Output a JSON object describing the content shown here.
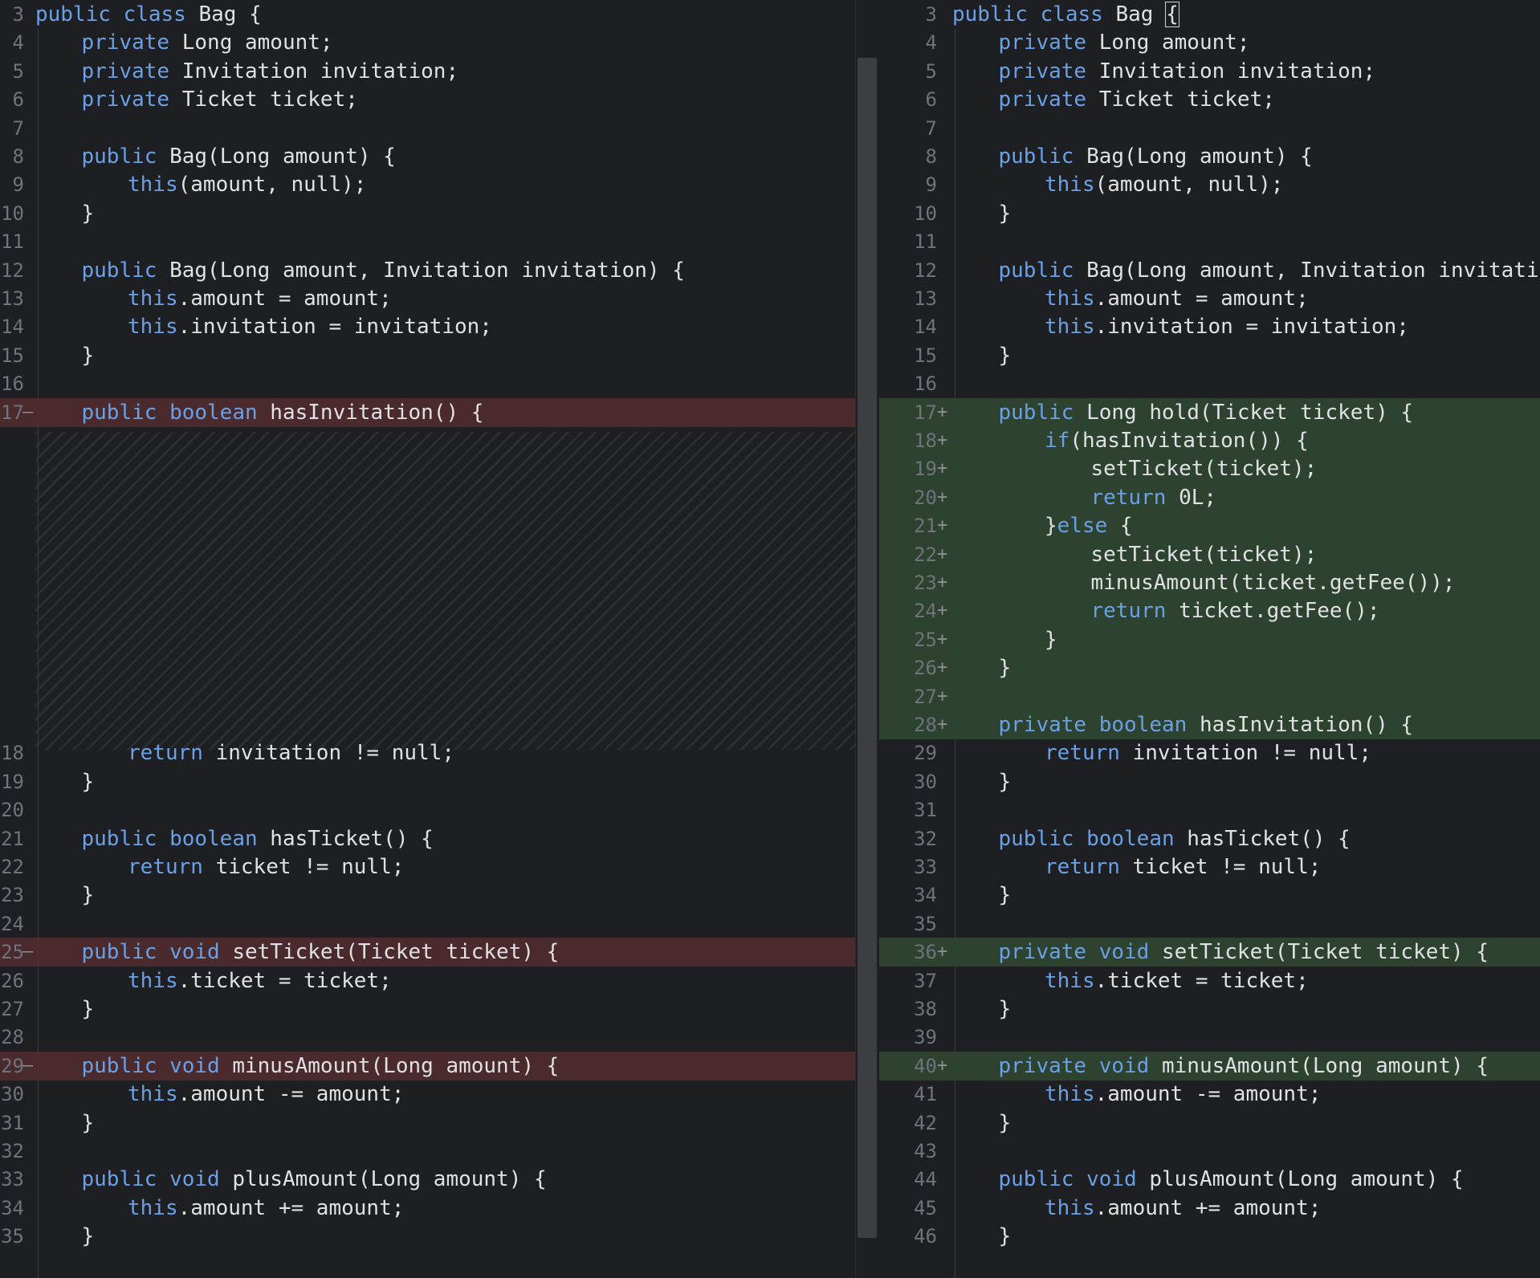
{
  "colors": {
    "background": "#1e1f22",
    "keyword": "#6aa0e6",
    "text": "#dfe1e5",
    "line_number": "#6f737a",
    "removed_bg": "#4a2a2d",
    "added_bg": "#2e4230"
  },
  "left_pane": {
    "rows": [
      {
        "line": "3",
        "marker": "",
        "status": "",
        "segments": [
          [
            "kw",
            "public class"
          ],
          [
            "",
            "Bag {"
          ]
        ],
        "indent": 0
      },
      {
        "line": "4",
        "marker": "",
        "status": "",
        "segments": [
          [
            "kw",
            "private"
          ],
          [
            "",
            " Long amount;"
          ]
        ],
        "indent": 1
      },
      {
        "line": "5",
        "marker": "",
        "status": "",
        "segments": [
          [
            "kw",
            "private"
          ],
          [
            "",
            " Invitation invitation;"
          ]
        ],
        "indent": 1
      },
      {
        "line": "6",
        "marker": "",
        "status": "",
        "segments": [
          [
            "kw",
            "private"
          ],
          [
            "",
            " Ticket ticket;"
          ]
        ],
        "indent": 1
      },
      {
        "line": "7",
        "marker": "",
        "status": "",
        "segments": [],
        "indent": 0
      },
      {
        "line": "8",
        "marker": "",
        "status": "",
        "segments": [
          [
            "kw",
            "public"
          ],
          [
            "",
            " Bag(Long amount) {"
          ]
        ],
        "indent": 1
      },
      {
        "line": "9",
        "marker": "",
        "status": "",
        "segments": [
          [
            "kw",
            "this"
          ],
          [
            "",
            "(amount, null);"
          ]
        ],
        "indent": 2
      },
      {
        "line": "10",
        "marker": "",
        "status": "",
        "segments": [
          [
            "",
            "}"
          ]
        ],
        "indent": 1
      },
      {
        "line": "11",
        "marker": "",
        "status": "",
        "segments": [],
        "indent": 0
      },
      {
        "line": "12",
        "marker": "",
        "status": "",
        "segments": [
          [
            "kw",
            "public"
          ],
          [
            "",
            " Bag(Long amount, Invitation invitation) {"
          ]
        ],
        "indent": 1
      },
      {
        "line": "13",
        "marker": "",
        "status": "",
        "segments": [
          [
            "kw",
            "this"
          ],
          [
            "",
            ".amount = amount;"
          ]
        ],
        "indent": 2
      },
      {
        "line": "14",
        "marker": "",
        "status": "",
        "segments": [
          [
            "kw",
            "this"
          ],
          [
            "",
            ".invitation = invitation;"
          ]
        ],
        "indent": 2
      },
      {
        "line": "15",
        "marker": "",
        "status": "",
        "segments": [
          [
            "",
            "}"
          ]
        ],
        "indent": 1
      },
      {
        "line": "16",
        "marker": "",
        "status": "",
        "segments": [],
        "indent": 0
      },
      {
        "line": "17",
        "marker": "–",
        "status": "removed",
        "segments": [
          [
            "kw",
            "public boolean"
          ],
          [
            "",
            " hasInvitation() {"
          ]
        ],
        "indent": 1
      },
      {
        "line": "",
        "marker": "",
        "status": "filler",
        "segments": [],
        "indent": 0
      },
      {
        "line": "",
        "marker": "",
        "status": "filler",
        "segments": [],
        "indent": 0
      },
      {
        "line": "",
        "marker": "",
        "status": "filler",
        "segments": [],
        "indent": 0
      },
      {
        "line": "",
        "marker": "",
        "status": "filler",
        "segments": [],
        "indent": 0
      },
      {
        "line": "",
        "marker": "",
        "status": "filler",
        "segments": [],
        "indent": 0
      },
      {
        "line": "",
        "marker": "",
        "status": "filler",
        "segments": [],
        "indent": 0
      },
      {
        "line": "",
        "marker": "",
        "status": "filler",
        "segments": [],
        "indent": 0
      },
      {
        "line": "",
        "marker": "",
        "status": "filler",
        "segments": [],
        "indent": 0
      },
      {
        "line": "",
        "marker": "",
        "status": "filler",
        "segments": [],
        "indent": 0
      },
      {
        "line": "",
        "marker": "",
        "status": "filler",
        "segments": [],
        "indent": 0
      },
      {
        "line": "",
        "marker": "",
        "status": "filler",
        "segments": [],
        "indent": 0
      },
      {
        "line": "18",
        "marker": "",
        "status": "",
        "segments": [
          [
            "kw",
            "return"
          ],
          [
            "",
            " invitation != null;"
          ]
        ],
        "indent": 2
      },
      {
        "line": "19",
        "marker": "",
        "status": "",
        "segments": [
          [
            "",
            "}"
          ]
        ],
        "indent": 1
      },
      {
        "line": "20",
        "marker": "",
        "status": "",
        "segments": [],
        "indent": 0
      },
      {
        "line": "21",
        "marker": "",
        "status": "",
        "segments": [
          [
            "kw",
            "public boolean"
          ],
          [
            "",
            " hasTicket() {"
          ]
        ],
        "indent": 1
      },
      {
        "line": "22",
        "marker": "",
        "status": "",
        "segments": [
          [
            "kw",
            "return"
          ],
          [
            "",
            " ticket != null;"
          ]
        ],
        "indent": 2
      },
      {
        "line": "23",
        "marker": "",
        "status": "",
        "segments": [
          [
            "",
            "}"
          ]
        ],
        "indent": 1
      },
      {
        "line": "24",
        "marker": "",
        "status": "",
        "segments": [],
        "indent": 0
      },
      {
        "line": "25",
        "marker": "–",
        "status": "removed",
        "segments": [
          [
            "kw",
            "public void"
          ],
          [
            "",
            " setTicket(Ticket ticket) {"
          ]
        ],
        "indent": 1
      },
      {
        "line": "26",
        "marker": "",
        "status": "",
        "segments": [
          [
            "kw",
            "this"
          ],
          [
            "",
            ".ticket = ticket;"
          ]
        ],
        "indent": 2
      },
      {
        "line": "27",
        "marker": "",
        "status": "",
        "segments": [
          [
            "",
            "}"
          ]
        ],
        "indent": 1
      },
      {
        "line": "28",
        "marker": "",
        "status": "",
        "segments": [],
        "indent": 0
      },
      {
        "line": "29",
        "marker": "–",
        "status": "removed",
        "segments": [
          [
            "kw",
            "public void"
          ],
          [
            "",
            " minusAmount(Long amount) {"
          ]
        ],
        "indent": 1
      },
      {
        "line": "30",
        "marker": "",
        "status": "",
        "segments": [
          [
            "kw",
            "this"
          ],
          [
            "",
            ".amount -= amount;"
          ]
        ],
        "indent": 2
      },
      {
        "line": "31",
        "marker": "",
        "status": "",
        "segments": [
          [
            "",
            "}"
          ]
        ],
        "indent": 1
      },
      {
        "line": "32",
        "marker": "",
        "status": "",
        "segments": [],
        "indent": 0
      },
      {
        "line": "33",
        "marker": "",
        "status": "",
        "segments": [
          [
            "kw",
            "public void"
          ],
          [
            "",
            " plusAmount(Long amount) {"
          ]
        ],
        "indent": 1
      },
      {
        "line": "34",
        "marker": "",
        "status": "",
        "segments": [
          [
            "kw",
            "this"
          ],
          [
            "",
            ".amount += amount;"
          ]
        ],
        "indent": 2
      },
      {
        "line": "35",
        "marker": "",
        "status": "",
        "segments": [
          [
            "",
            "}"
          ]
        ],
        "indent": 1
      }
    ]
  },
  "right_pane": {
    "rows": [
      {
        "line": "3",
        "marker": "",
        "status": "",
        "segments": [
          [
            "kw",
            "public class"
          ],
          [
            "",
            "Bag "
          ],
          [
            "cursor",
            "{"
          ]
        ],
        "indent": 0
      },
      {
        "line": "4",
        "marker": "",
        "status": "",
        "segments": [
          [
            "kw",
            "private"
          ],
          [
            "",
            " Long amount;"
          ]
        ],
        "indent": 1
      },
      {
        "line": "5",
        "marker": "",
        "status": "",
        "segments": [
          [
            "kw",
            "private"
          ],
          [
            "",
            " Invitation invitation;"
          ]
        ],
        "indent": 1
      },
      {
        "line": "6",
        "marker": "",
        "status": "",
        "segments": [
          [
            "kw",
            "private"
          ],
          [
            "",
            " Ticket ticket;"
          ]
        ],
        "indent": 1
      },
      {
        "line": "7",
        "marker": "",
        "status": "",
        "segments": [],
        "indent": 0
      },
      {
        "line": "8",
        "marker": "",
        "status": "",
        "segments": [
          [
            "kw",
            "public"
          ],
          [
            "",
            " Bag(Long amount) {"
          ]
        ],
        "indent": 1
      },
      {
        "line": "9",
        "marker": "",
        "status": "",
        "segments": [
          [
            "kw",
            "this"
          ],
          [
            "",
            "(amount, null);"
          ]
        ],
        "indent": 2
      },
      {
        "line": "10",
        "marker": "",
        "status": "",
        "segments": [
          [
            "",
            "}"
          ]
        ],
        "indent": 1
      },
      {
        "line": "11",
        "marker": "",
        "status": "",
        "segments": [],
        "indent": 0
      },
      {
        "line": "12",
        "marker": "",
        "status": "",
        "segments": [
          [
            "kw",
            "public"
          ],
          [
            "",
            " Bag(Long amount, Invitation invitation)"
          ]
        ],
        "indent": 1
      },
      {
        "line": "13",
        "marker": "",
        "status": "",
        "segments": [
          [
            "kw",
            "this"
          ],
          [
            "",
            ".amount = amount;"
          ]
        ],
        "indent": 2
      },
      {
        "line": "14",
        "marker": "",
        "status": "",
        "segments": [
          [
            "kw",
            "this"
          ],
          [
            "",
            ".invitation = invitation;"
          ]
        ],
        "indent": 2
      },
      {
        "line": "15",
        "marker": "",
        "status": "",
        "segments": [
          [
            "",
            "}"
          ]
        ],
        "indent": 1
      },
      {
        "line": "16",
        "marker": "",
        "status": "",
        "segments": [],
        "indent": 0
      },
      {
        "line": "17",
        "marker": "+",
        "status": "added",
        "segments": [
          [
            "kw",
            "public"
          ],
          [
            "",
            " Long hold(Ticket ticket) {"
          ]
        ],
        "indent": 1
      },
      {
        "line": "18",
        "marker": "+",
        "status": "added",
        "segments": [
          [
            "kw",
            "if"
          ],
          [
            "",
            "(hasInvitation()) {"
          ]
        ],
        "indent": 2
      },
      {
        "line": "19",
        "marker": "+",
        "status": "added",
        "segments": [
          [
            "",
            "setTicket(ticket);"
          ]
        ],
        "indent": 3
      },
      {
        "line": "20",
        "marker": "+",
        "status": "added",
        "segments": [
          [
            "kw",
            "return"
          ],
          [
            "",
            " 0L;"
          ]
        ],
        "indent": 3
      },
      {
        "line": "21",
        "marker": "+",
        "status": "added",
        "segments": [
          [
            "",
            "}"
          ],
          [
            "kw",
            "else"
          ],
          [
            "",
            " {"
          ]
        ],
        "indent": 2
      },
      {
        "line": "22",
        "marker": "+",
        "status": "added",
        "segments": [
          [
            "",
            "setTicket(ticket);"
          ]
        ],
        "indent": 3
      },
      {
        "line": "23",
        "marker": "+",
        "status": "added",
        "segments": [
          [
            "",
            "minusAmount(ticket.getFee());"
          ]
        ],
        "indent": 3
      },
      {
        "line": "24",
        "marker": "+",
        "status": "added",
        "segments": [
          [
            "kw",
            "return"
          ],
          [
            "",
            " ticket.getFee();"
          ]
        ],
        "indent": 3
      },
      {
        "line": "25",
        "marker": "+",
        "status": "added",
        "segments": [
          [
            "",
            "}"
          ]
        ],
        "indent": 2
      },
      {
        "line": "26",
        "marker": "+",
        "status": "added",
        "segments": [
          [
            "",
            "}"
          ]
        ],
        "indent": 1
      },
      {
        "line": "27",
        "marker": "+",
        "status": "added",
        "segments": [],
        "indent": 0
      },
      {
        "line": "28",
        "marker": "+",
        "status": "added",
        "segments": [
          [
            "kw",
            "private boolean"
          ],
          [
            "",
            " hasInvitation() {"
          ]
        ],
        "indent": 1
      },
      {
        "line": "29",
        "marker": "",
        "status": "",
        "segments": [
          [
            "kw",
            "return"
          ],
          [
            "",
            " invitation != null;"
          ]
        ],
        "indent": 2
      },
      {
        "line": "30",
        "marker": "",
        "status": "",
        "segments": [
          [
            "",
            "}"
          ]
        ],
        "indent": 1
      },
      {
        "line": "31",
        "marker": "",
        "status": "",
        "segments": [],
        "indent": 0
      },
      {
        "line": "32",
        "marker": "",
        "status": "",
        "segments": [
          [
            "kw",
            "public boolean"
          ],
          [
            "",
            " hasTicket() {"
          ]
        ],
        "indent": 1
      },
      {
        "line": "33",
        "marker": "",
        "status": "",
        "segments": [
          [
            "kw",
            "return"
          ],
          [
            "",
            " ticket != null;"
          ]
        ],
        "indent": 2
      },
      {
        "line": "34",
        "marker": "",
        "status": "",
        "segments": [
          [
            "",
            "}"
          ]
        ],
        "indent": 1
      },
      {
        "line": "35",
        "marker": "",
        "status": "",
        "segments": [],
        "indent": 0
      },
      {
        "line": "36",
        "marker": "+",
        "status": "added",
        "segments": [
          [
            "kw",
            "private void"
          ],
          [
            "",
            " setTicket(Ticket ticket) {"
          ]
        ],
        "indent": 1
      },
      {
        "line": "37",
        "marker": "",
        "status": "",
        "segments": [
          [
            "kw",
            "this"
          ],
          [
            "",
            ".ticket = ticket;"
          ]
        ],
        "indent": 2
      },
      {
        "line": "38",
        "marker": "",
        "status": "",
        "segments": [
          [
            "",
            "}"
          ]
        ],
        "indent": 1
      },
      {
        "line": "39",
        "marker": "",
        "status": "",
        "segments": [],
        "indent": 0
      },
      {
        "line": "40",
        "marker": "+",
        "status": "added",
        "segments": [
          [
            "kw",
            "private void"
          ],
          [
            "",
            " minusAmount(Long amount) {"
          ]
        ],
        "indent": 1
      },
      {
        "line": "41",
        "marker": "",
        "status": "",
        "segments": [
          [
            "kw",
            "this"
          ],
          [
            "",
            ".amount -= amount;"
          ]
        ],
        "indent": 2
      },
      {
        "line": "42",
        "marker": "",
        "status": "",
        "segments": [
          [
            "",
            "}"
          ]
        ],
        "indent": 1
      },
      {
        "line": "43",
        "marker": "",
        "status": "",
        "segments": [],
        "indent": 0
      },
      {
        "line": "44",
        "marker": "",
        "status": "",
        "segments": [
          [
            "kw",
            "public void"
          ],
          [
            "",
            " plusAmount(Long amount) {"
          ]
        ],
        "indent": 1
      },
      {
        "line": "45",
        "marker": "",
        "status": "",
        "segments": [
          [
            "kw",
            "this"
          ],
          [
            "",
            ".amount += amount;"
          ]
        ],
        "indent": 2
      },
      {
        "line": "46",
        "marker": "",
        "status": "",
        "segments": [
          [
            "",
            "}"
          ]
        ],
        "indent": 1
      }
    ]
  }
}
